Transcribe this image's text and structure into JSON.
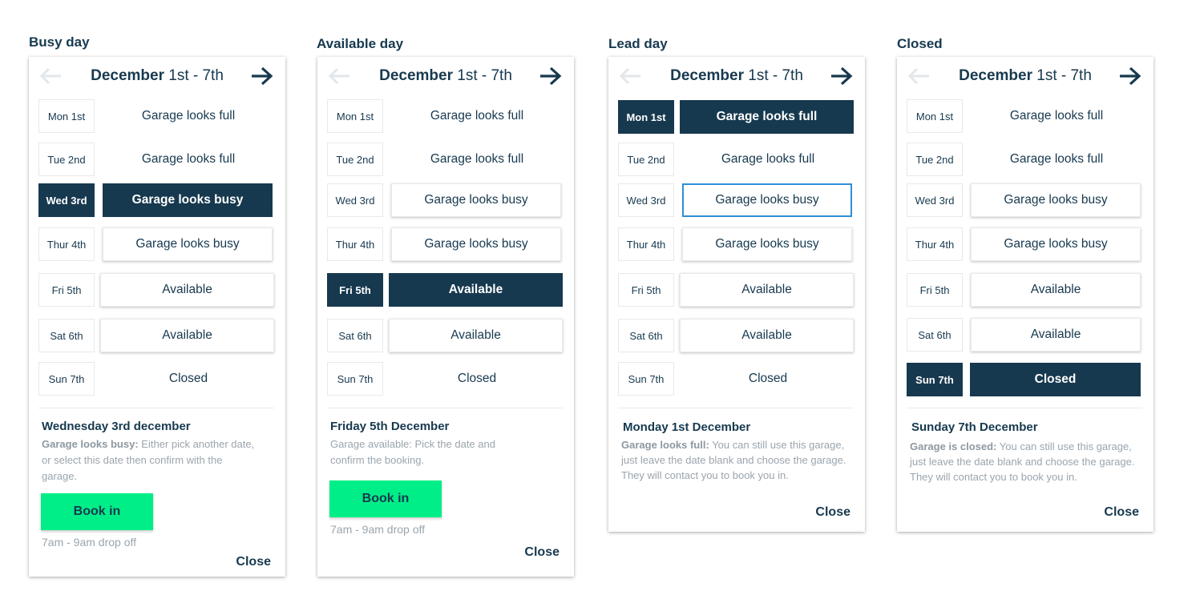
{
  "nav_icons": {
    "prev": "arrow-left-icon",
    "next": "arrow-right-icon"
  },
  "colors": {
    "navy": "#17394f",
    "accent_green": "#00ee88",
    "outline_blue": "#2f8fd6",
    "muted": "#9aa5ae"
  },
  "panels": [
    {
      "panel_title": "Busy day",
      "header_month": "December",
      "header_range": " 1st - 7th",
      "rows": [
        {
          "day": "Mon 1st",
          "status": "Garage looks full"
        },
        {
          "day": "Tue 2nd",
          "status": "Garage looks full"
        },
        {
          "day": "Wed 3rd",
          "status": "Garage looks busy"
        },
        {
          "day": "Thur 4th",
          "status": "Garage looks busy"
        },
        {
          "day": "Fri 5th",
          "status": "Available"
        },
        {
          "day": "Sat 6th",
          "status": "Available"
        },
        {
          "day": "Sun 7th",
          "status": "Closed"
        }
      ],
      "info_title": "Wednesday 3rd december",
      "info_bold": "Garage looks busy:",
      "info_text": " Either pick another date, or select this date then confirm with the garage.",
      "book_label": "Book in",
      "dropoff": "7am - 9am drop off",
      "close_label": "Close"
    },
    {
      "panel_title": "Available day",
      "header_month": "December",
      "header_range": " 1st - 7th",
      "rows": [
        {
          "day": "Mon 1st",
          "status": "Garage looks full"
        },
        {
          "day": "Tue 2nd",
          "status": "Garage looks full"
        },
        {
          "day": "Wed 3rd",
          "status": "Garage looks busy"
        },
        {
          "day": "Thur 4th",
          "status": "Garage looks busy"
        },
        {
          "day": "Fri 5th",
          "status": "Available"
        },
        {
          "day": "Sat 6th",
          "status": "Available"
        },
        {
          "day": "Sun 7th",
          "status": "Closed"
        }
      ],
      "info_title": "Friday 5th December",
      "info_text": "Garage available: Pick the date and confirm the booking.",
      "book_label": "Book in",
      "dropoff": "7am - 9am drop off",
      "close_label": "Close"
    },
    {
      "panel_title": "Lead day",
      "header_month": "December",
      "header_range": " 1st - 7th",
      "rows": [
        {
          "day": "Mon 1st",
          "status": "Garage looks full"
        },
        {
          "day": "Tue 2nd",
          "status": "Garage looks full"
        },
        {
          "day": "Wed 3rd",
          "status": "Garage looks busy"
        },
        {
          "day": "Thur 4th",
          "status": "Garage looks busy"
        },
        {
          "day": "Fri 5th",
          "status": "Available"
        },
        {
          "day": "Sat 6th",
          "status": "Available"
        },
        {
          "day": "Sun 7th",
          "status": "Closed"
        }
      ],
      "info_title": "Monday 1st December",
      "info_bold": "Garage looks full:",
      "info_text": " You can still use this garage, just leave the date blank and choose the garage. They will contact you to book you in.",
      "close_label": "Close"
    },
    {
      "panel_title": "Closed",
      "header_month": "December",
      "header_range": " 1st - 7th",
      "rows": [
        {
          "day": "Mon 1st",
          "status": "Garage looks full"
        },
        {
          "day": "Tue 2nd",
          "status": "Garage looks full"
        },
        {
          "day": "Wed 3rd",
          "status": "Garage looks busy"
        },
        {
          "day": "Thur 4th",
          "status": "Garage looks busy"
        },
        {
          "day": "Fri 5th",
          "status": "Available"
        },
        {
          "day": "Sat 6th",
          "status": "Available"
        },
        {
          "day": "Sun 7th",
          "status": "Closed"
        }
      ],
      "info_title": "Sunday 7th December",
      "info_bold": "Garage is closed:",
      "info_text": " You can still use this garage, just leave the date blank and choose the garage. They will contact you to book you in.",
      "close_label": "Close"
    }
  ]
}
